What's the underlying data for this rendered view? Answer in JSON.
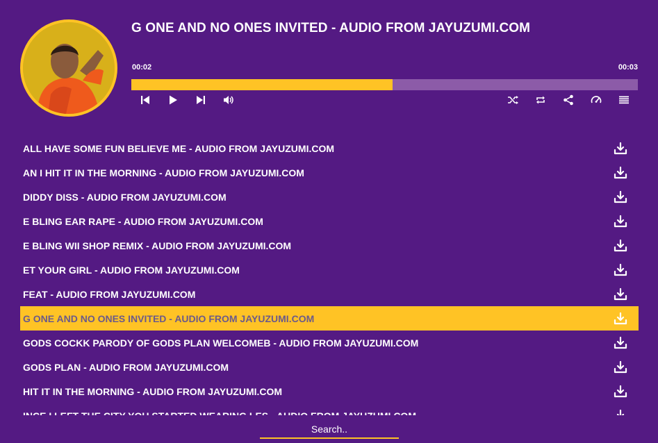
{
  "player": {
    "title": "G ONE AND NO ONES INVITED - AUDIO FROM JAYUZUMI.COM",
    "current_time": "00:02",
    "duration": "00:03",
    "progress_fraction": 0.516
  },
  "controls": {
    "left": [
      "previous-icon",
      "play-icon",
      "next-icon",
      "volume-icon"
    ],
    "right": [
      "shuffle-icon",
      "repeat-icon",
      "share-icon",
      "speed-icon",
      "playlist-icon"
    ]
  },
  "playlist": {
    "active_index": 7,
    "items": [
      "ALL HAVE SOME FUN BELIEVE ME - AUDIO FROM JAYUZUMI.COM",
      "AN I HIT IT IN THE MORNING - AUDIO FROM JAYUZUMI.COM",
      "DIDDY DISS - AUDIO FROM JAYUZUMI.COM",
      "E BLING EAR RAPE - AUDIO FROM JAYUZUMI.COM",
      "E BLING WII SHOP REMIX - AUDIO FROM JAYUZUMI.COM",
      "ET YOUR GIRL - AUDIO FROM JAYUZUMI.COM",
      "FEAT - AUDIO FROM JAYUZUMI.COM",
      "G ONE AND NO ONES INVITED - AUDIO FROM JAYUZUMI.COM",
      "GODS COCKK PARODY OF GODS PLAN WELCOMEB - AUDIO FROM JAYUZUMI.COM",
      "GODS PLAN - AUDIO FROM JAYUZUMI.COM",
      "HIT IT IN THE MORNING - AUDIO FROM JAYUZUMI.COM",
      "INCE I LEFT THE CITY YOU STARTED WEARING LES - AUDIO FROM JAYUZUMI.COM"
    ]
  },
  "search": {
    "placeholder": "Search.."
  },
  "colors": {
    "background": "#541a83",
    "accent": "#ffc325",
    "track": "#8c5ba8"
  }
}
